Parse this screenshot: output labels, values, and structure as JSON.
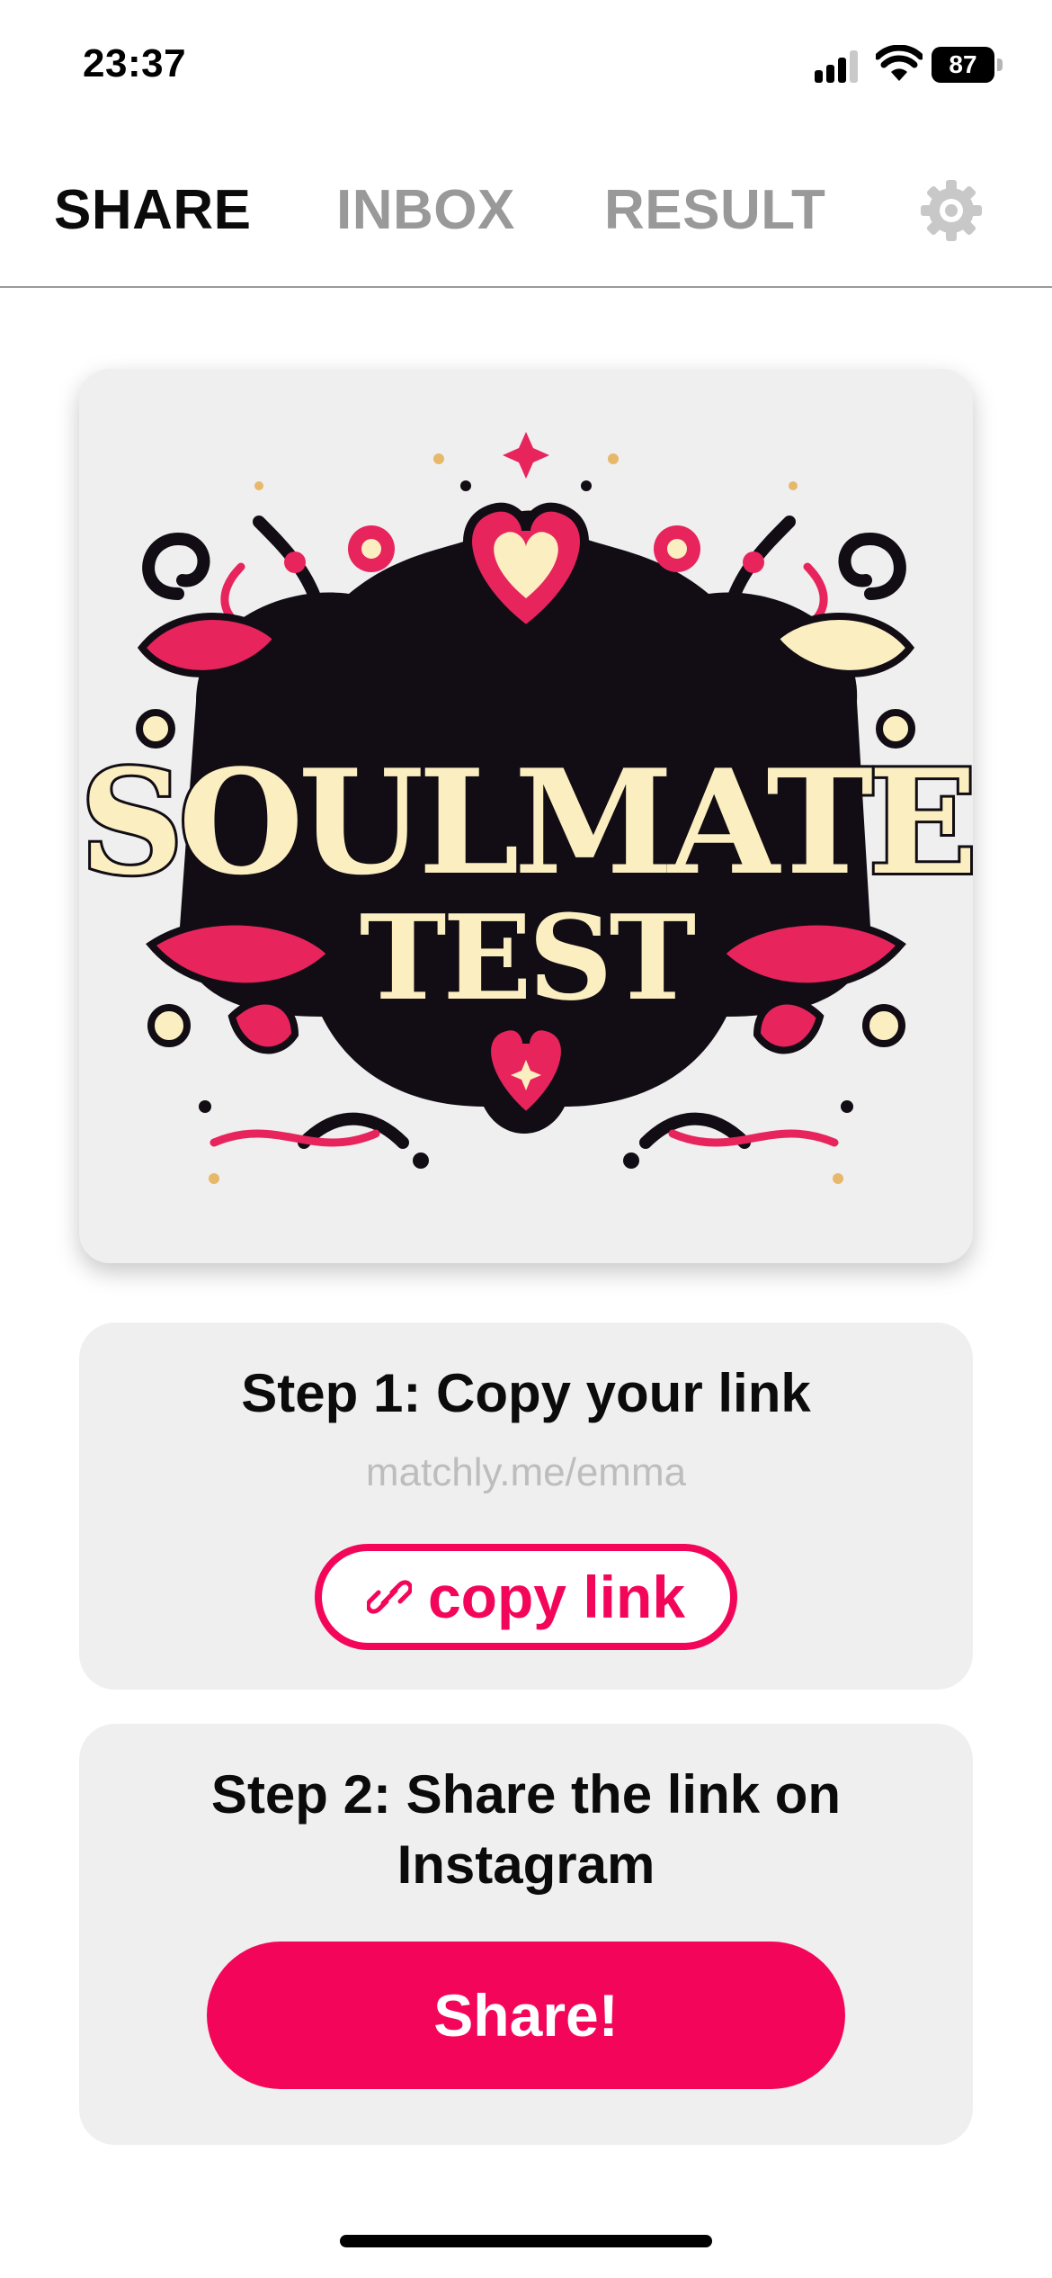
{
  "status_bar": {
    "time": "23:37",
    "battery": "87"
  },
  "tabs": [
    {
      "label": "SHARE",
      "active": true
    },
    {
      "label": "INBOX",
      "active": false
    },
    {
      "label": "RESULT",
      "active": false
    }
  ],
  "settings_icon": "gear-icon",
  "hero": {
    "title_line1": "SOULMATE",
    "title_line2": "TEST"
  },
  "step1": {
    "title": "Step 1: Copy your link",
    "link": "matchly.me/emma",
    "button_label": "copy link",
    "button_icon": "link-icon"
  },
  "step2": {
    "title_line1": "Step 2: Share the link on",
    "title_line2": "Instagram",
    "button_label": "Share!"
  },
  "colors": {
    "accent": "#f3065a",
    "card_bg": "#efefef",
    "inactive_tab": "#999999",
    "hero_cream": "#fbefc2",
    "hero_dark": "#120d14",
    "hero_pink": "#e8245d"
  }
}
